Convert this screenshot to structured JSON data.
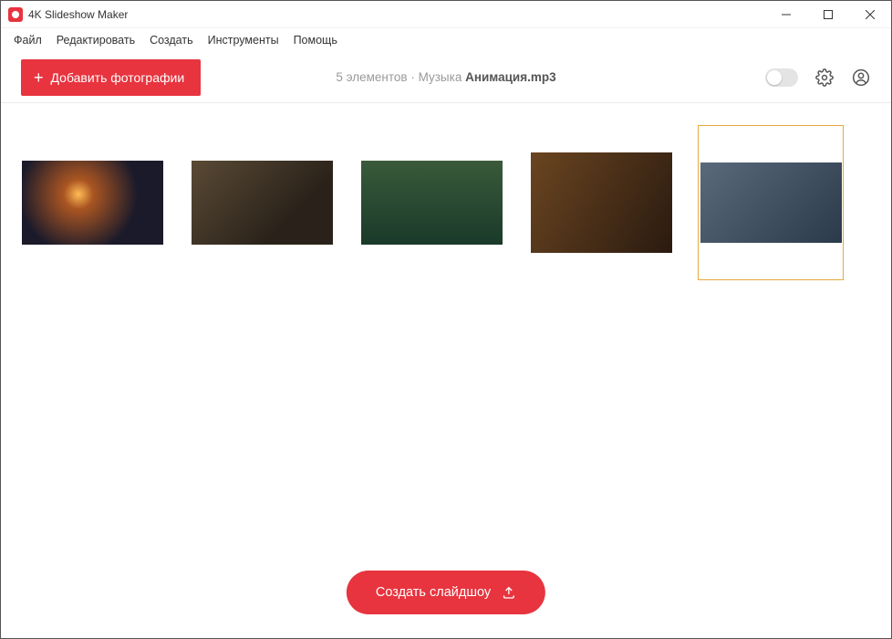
{
  "titlebar": {
    "title": "4K Slideshow Maker"
  },
  "menu": {
    "file": "Файл",
    "edit": "Редактировать",
    "create": "Создать",
    "tools": "Инструменты",
    "help": "Помощь"
  },
  "toolbar": {
    "add_photos": "Добавить фотографии",
    "status_prefix": "5 элементов · Музыка ",
    "status_track": "Анимация.mp3"
  },
  "thumbnails": [
    {
      "id": "photo-1",
      "selected": false
    },
    {
      "id": "photo-2",
      "selected": false
    },
    {
      "id": "photo-3",
      "selected": false
    },
    {
      "id": "photo-4",
      "selected": false
    },
    {
      "id": "photo-5",
      "selected": true
    }
  ],
  "footer": {
    "create_slideshow": "Создать слайдшоу"
  },
  "colors": {
    "accent": "#e7343f",
    "selected_border": "#e8a83e"
  }
}
